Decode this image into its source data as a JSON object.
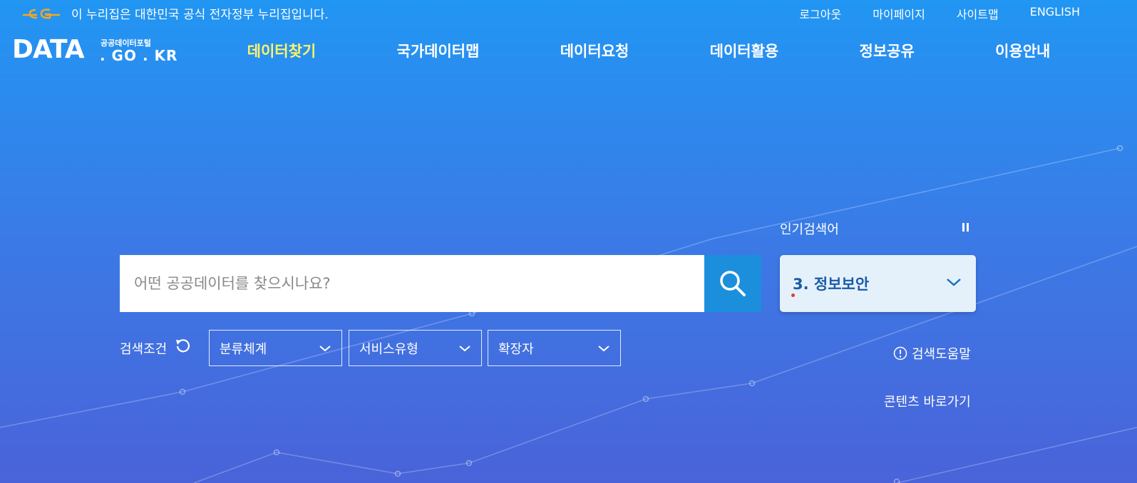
{
  "top_bar": {
    "gov_notice": "이 누리집은 대한민국 공식 전자정부 누리집입니다.",
    "links": [
      "로그아웃",
      "마이페이지",
      "사이트맵",
      "ENGLISH"
    ]
  },
  "logo": {
    "main": "DATA",
    "sub": "공공데이터포털",
    "domain": ". GO . KR"
  },
  "nav": {
    "items": [
      "데이터찾기",
      "국가데이터맵",
      "데이터요청",
      "데이터활용",
      "정보공유",
      "이용안내"
    ]
  },
  "search": {
    "placeholder": "어떤 공공데이터를 찾으시나요?",
    "value": ""
  },
  "popular": {
    "label": "인기검색어",
    "current": "3. 정보보안"
  },
  "conditions": {
    "label": "검색조건",
    "selects": [
      "분류체계",
      "서비스유형",
      "확장자"
    ]
  },
  "help_label": "검색도움말",
  "shortcut_label": "콘텐츠 바로가기",
  "colors": {
    "active_nav": "#fff36a",
    "search_button": "#1b8fdc",
    "popular_box": "#e4f1fb",
    "popular_text": "#1a5ba6"
  }
}
